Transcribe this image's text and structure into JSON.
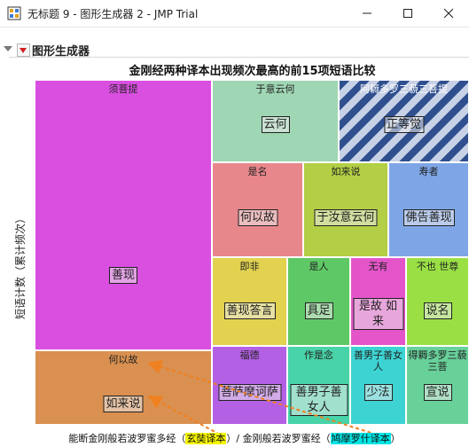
{
  "window": {
    "title": "无标题 9 - 图形生成器 2 - JMP Trial",
    "minimize_glyph": "—",
    "maximize_glyph": "☐",
    "close_glyph": "✕"
  },
  "section": {
    "title": "图形生成器"
  },
  "chart_data": {
    "type": "treemap",
    "title": "金刚经两种译本出现频次最高的前15项短语比较",
    "ylabel": "短语计数（累计频次）",
    "legend": {
      "prefix": "能断金刚般若波罗蜜多经（",
      "yellow_label": "玄奘译本",
      "middle": "）/ 金刚般若波罗蜜经（",
      "cyan_label": "鸠摩罗什译本",
      "suffix": "）"
    },
    "colors": {
      "xuanzang": "#f4f400",
      "kumarajiva": "#00e5e5"
    },
    "tiles": [
      {
        "category": "须菩提",
        "phrase": "善现",
        "color": "#d94fe0"
      },
      {
        "category": "何以故",
        "phrase": "如来说",
        "color": "#d99050"
      },
      {
        "category": "于意云何",
        "phrase": "云何",
        "color": "#9fd6b3"
      },
      {
        "category": "阿耨多罗三藐三菩提",
        "phrase": "正等觉",
        "color": "hatch"
      },
      {
        "category": "是名",
        "phrase": "何以故",
        "color": "#e8878b"
      },
      {
        "category": "如来说",
        "phrase": "于汝意云何",
        "color": "#b3cf45"
      },
      {
        "category": "寿者",
        "phrase": "佛告善现",
        "color": "#7ea6e6"
      },
      {
        "category": "即非",
        "phrase": "善现答言",
        "color": "#e2d250"
      },
      {
        "category": "是人",
        "phrase": "具足",
        "color": "#5fc866"
      },
      {
        "category": "无有",
        "phrase": "是故 如来",
        "color": "#e455c9"
      },
      {
        "category": "不也 世尊",
        "phrase": "说名",
        "color": "#9ae045"
      },
      {
        "category": "福德",
        "phrase": "菩萨摩诃萨",
        "color": "#b460e4"
      },
      {
        "category": "作是念",
        "phrase": "善男子善女人",
        "color": "#48d3a8"
      },
      {
        "category": "善男子善女人",
        "phrase": "少法",
        "color": "#3ed3d3"
      },
      {
        "category": "得耨多罗三藐三菩",
        "phrase": "宣说",
        "color": "#68d19a"
      }
    ]
  }
}
